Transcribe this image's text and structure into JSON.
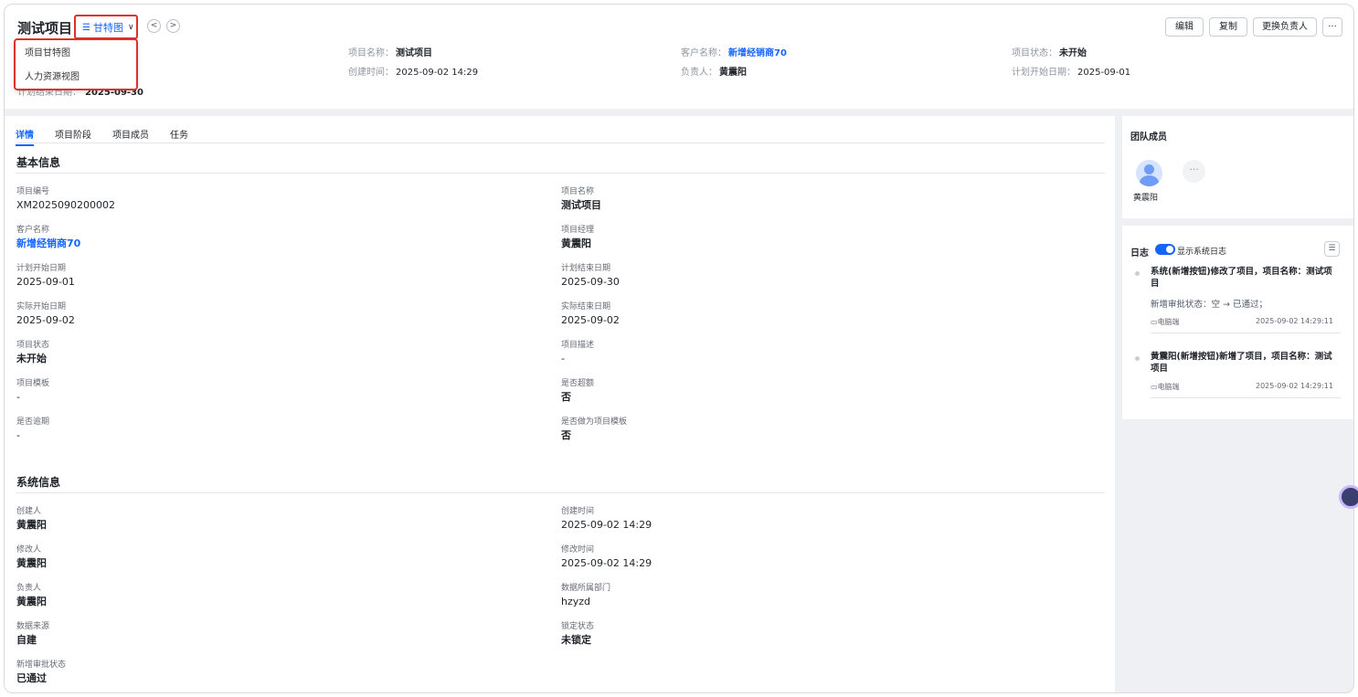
{
  "header": {
    "title": "测试项目",
    "view_label": "甘特图",
    "prev_label": "<",
    "next_label": ">",
    "dropdown_items": [
      "项目甘特图",
      "人力资源视图"
    ],
    "hidden_end_date_label": "计划结束日期：",
    "hidden_end_date_value": "2025-09-30",
    "meta": [
      {
        "label": "项目名称：",
        "value": "测试项目"
      },
      {
        "label": "客户名称：",
        "value": "新增经销商70"
      },
      {
        "label": "项目状态：",
        "value": "未开始"
      },
      {
        "label": "创建时间：",
        "value": "2025-09-02 14:29"
      },
      {
        "label": "负责人：",
        "value": "黄震阳"
      },
      {
        "label": "计划开始日期：",
        "value": "2025-09-01"
      }
    ],
    "buttons": {
      "edit": "编辑",
      "copy": "复制",
      "change_owner": "更换负责人",
      "more": "···"
    }
  },
  "tabs": [
    "详情",
    "项目阶段",
    "项目成员",
    "任务"
  ],
  "basic_info": {
    "title": "基本信息",
    "fields": [
      {
        "label": "项目编号",
        "value": "XM2025090200002"
      },
      {
        "label": "项目名称",
        "value": "测试项目"
      },
      {
        "label": "客户名称",
        "value": "新增经销商70"
      },
      {
        "label": "项目经理",
        "value": "黄震阳"
      },
      {
        "label": "计划开始日期",
        "value": "2025-09-01"
      },
      {
        "label": "计划结束日期",
        "value": "2025-09-30"
      },
      {
        "label": "实际开始日期",
        "value": "2025-09-02"
      },
      {
        "label": "实际结束日期",
        "value": "2025-09-02"
      },
      {
        "label": "项目状态",
        "value": "未开始"
      },
      {
        "label": "项目描述",
        "value": "-"
      },
      {
        "label": "项目模板",
        "value": "-"
      },
      {
        "label": "是否超额",
        "value": "否"
      },
      {
        "label": "是否逾期",
        "value": "-"
      },
      {
        "label": "是否做为项目模板",
        "value": "否"
      }
    ]
  },
  "system_info": {
    "title": "系统信息",
    "fields": [
      {
        "label": "创建人",
        "value": "黄震阳"
      },
      {
        "label": "创建时间",
        "value": "2025-09-02 14:29"
      },
      {
        "label": "修改人",
        "value": "黄震阳"
      },
      {
        "label": "修改时间",
        "value": "2025-09-02 14:29"
      },
      {
        "label": "负责人",
        "value": "黄震阳"
      },
      {
        "label": "数据所属部门",
        "value": "hzyzd"
      },
      {
        "label": "数据来源",
        "value": "自建"
      },
      {
        "label": "锁定状态",
        "value": "未锁定"
      },
      {
        "label": "新增审批状态",
        "value": "已通过"
      }
    ]
  },
  "team": {
    "title": "团队成员",
    "member_name": "黄震阳",
    "more_label": "···"
  },
  "log": {
    "title": "日志",
    "toggle_label": "显示系统日志",
    "toggle_on": true,
    "entries": [
      {
        "text": "系统(新增按钮)修改了项目，项目名称：测试项目",
        "detail": "新增审批状态：空 → 已通过；",
        "source": "电脑端",
        "time": "2025-09-02 14:29:11"
      },
      {
        "text": "黄震阳(新增按钮)新增了项目，项目名称：测试项目",
        "detail": "",
        "source": "电脑端",
        "time": "2025-09-02 14:29:11"
      }
    ]
  },
  "colors": {
    "accent": "#1664ff",
    "highlight_box": "#e0302a",
    "page_bg": "#eef0f3"
  }
}
